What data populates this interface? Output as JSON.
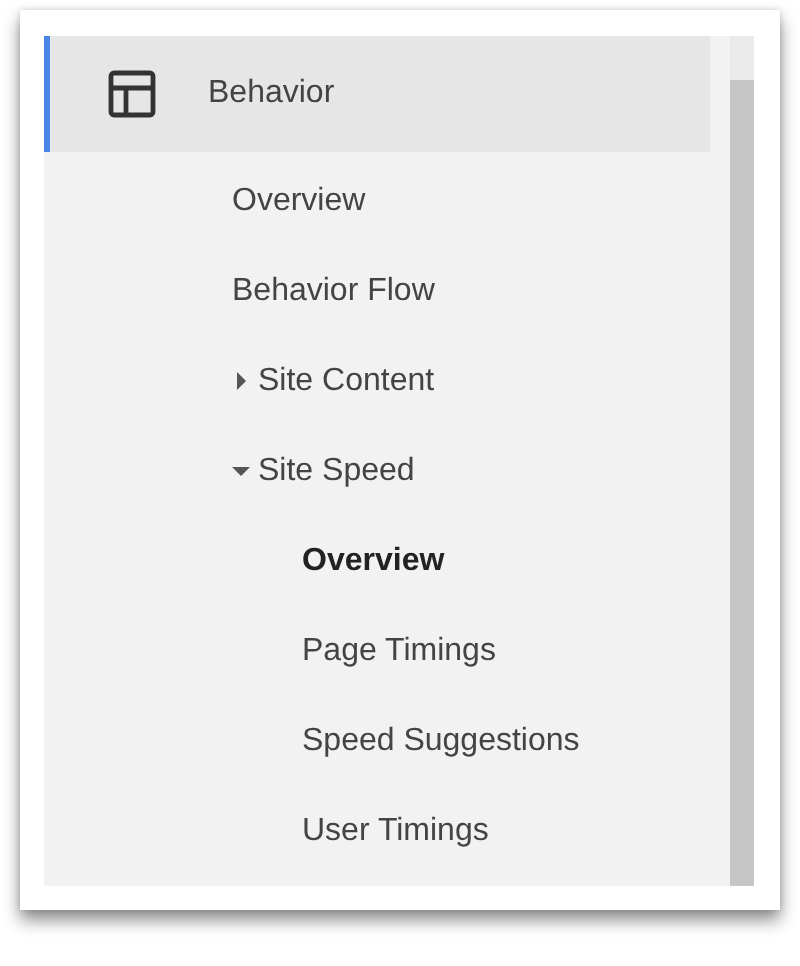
{
  "section": {
    "title": "Behavior",
    "selected": true
  },
  "items": [
    {
      "label": "Overview",
      "selected": false
    },
    {
      "label": "Behavior Flow",
      "selected": false
    },
    {
      "label": "Site Content",
      "selected": false,
      "expanded": false
    },
    {
      "label": "Site Speed",
      "selected": false,
      "expanded": true,
      "children": [
        {
          "label": "Overview",
          "selected": true
        },
        {
          "label": "Page Timings",
          "selected": false
        },
        {
          "label": "Speed Suggestions",
          "selected": false
        },
        {
          "label": "User Timings",
          "selected": false
        }
      ]
    }
  ]
}
